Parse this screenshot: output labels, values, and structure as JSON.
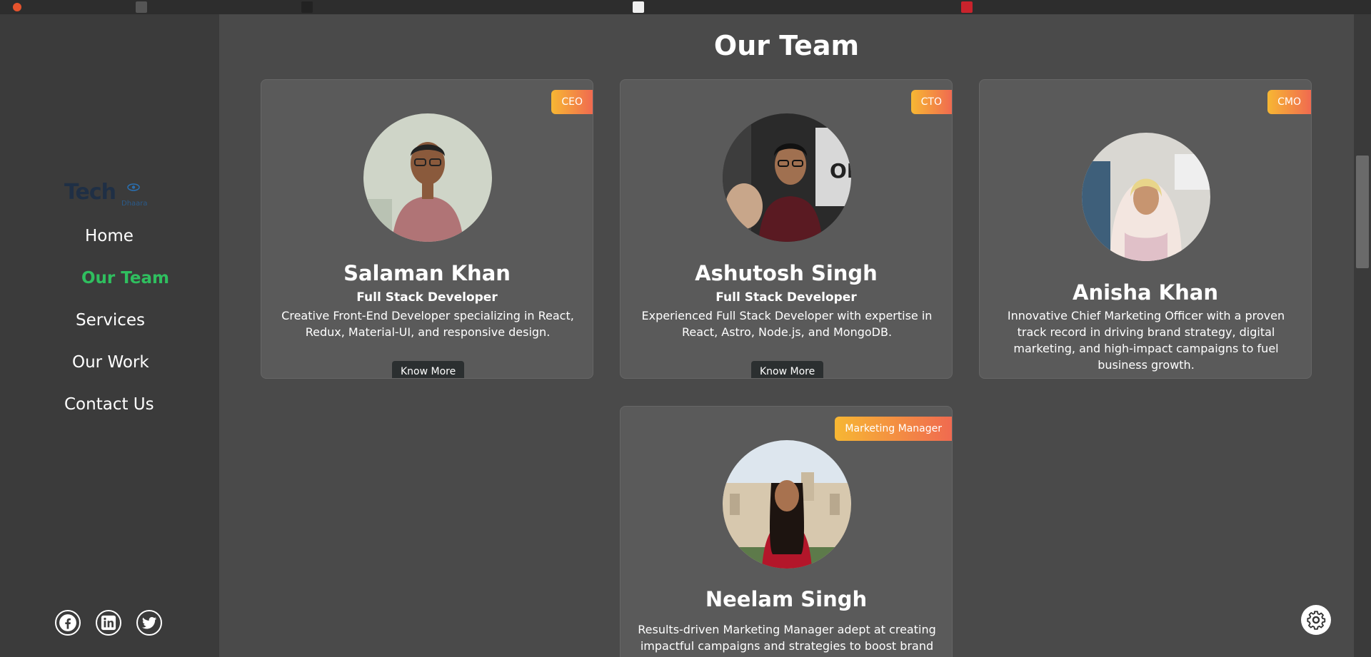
{
  "brand": {
    "logo_text": "Tech",
    "logo_sub": "Dhaara"
  },
  "nav": {
    "home": "Home",
    "team": "Our Team",
    "services": "Services",
    "work": "Our Work",
    "contact": "Contact Us"
  },
  "socials": {
    "facebook": "facebook-icon",
    "linkedin": "linkedin-icon",
    "twitter": "twitter-icon"
  },
  "page": {
    "title": "Our Team"
  },
  "team": [
    {
      "badge": "CEO",
      "name": "Salaman Khan",
      "role": "Full Stack Developer",
      "description": "Creative Front-End Developer specializing in React, Redux, Material-UI, and responsive design.",
      "button": "Know More"
    },
    {
      "badge": "CTO",
      "name": "Ashutosh Singh",
      "role": "Full Stack Developer",
      "description": "Experienced Full Stack Developer with expertise in React, Astro, Node.js, and MongoDB.",
      "button": "Know More"
    },
    {
      "badge": "CMO",
      "name": "Anisha Khan",
      "description": "Innovative Chief Marketing Officer with a proven track record in driving brand strategy, digital marketing, and high-impact campaigns to fuel business growth."
    },
    {
      "badge": "Marketing Manager",
      "name": "Neelam Singh",
      "description": "Results-driven Marketing Manager adept at creating impactful campaigns and strategies to boost brand growth and customer engagement."
    }
  ],
  "colors": {
    "accent": "#2fbf5f",
    "badge_start": "#f7b733",
    "badge_end": "#f06a50",
    "card": "#5a5a5a",
    "sidebar": "#3b3b3b"
  },
  "theme_toggle_icon": "gear-icon"
}
